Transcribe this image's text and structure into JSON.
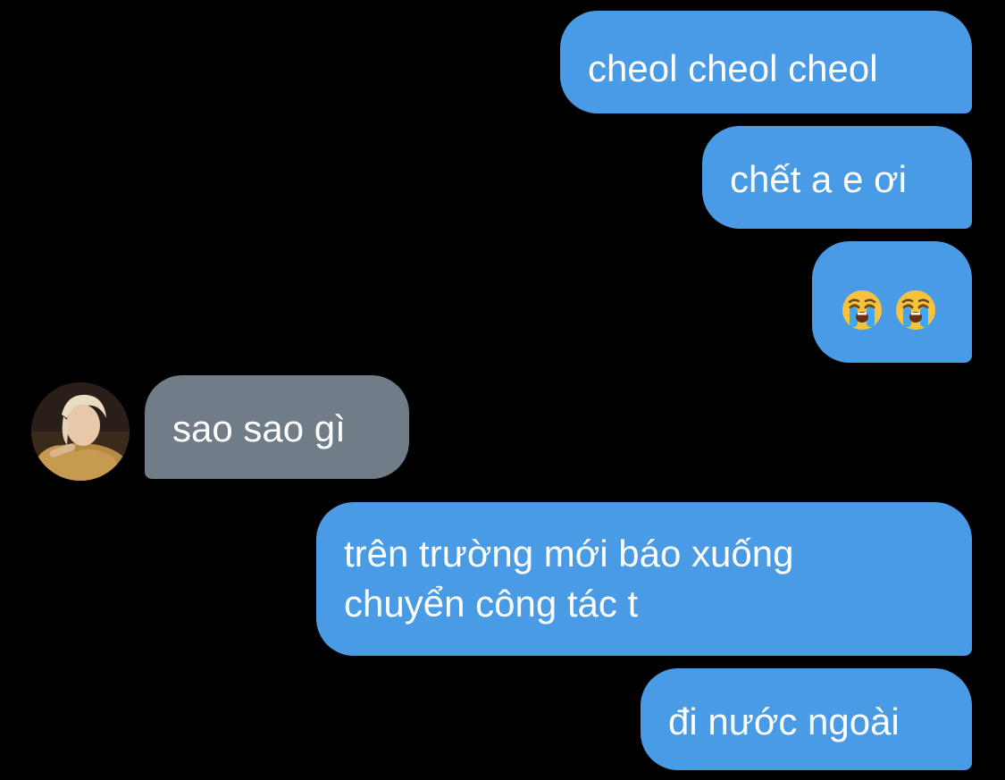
{
  "colors": {
    "background": "#000000",
    "outgoing_bubble": "#4a9be6",
    "incoming_bubble": "#707c87",
    "text": "#ffffff"
  },
  "messages": [
    {
      "direction": "outgoing",
      "text": "cheol cheol cheol"
    },
    {
      "direction": "outgoing",
      "text": "chết a e ơi"
    },
    {
      "direction": "outgoing",
      "emoji": [
        "loudly-crying-face",
        "loudly-crying-face"
      ]
    },
    {
      "direction": "incoming",
      "text": "sao sao gì",
      "avatar": "contact-avatar"
    },
    {
      "direction": "outgoing",
      "text_line1": "trên trường mới báo xuống",
      "text_line2": "chuyển công tác t"
    },
    {
      "direction": "outgoing",
      "text": "đi nước ngoài"
    }
  ]
}
